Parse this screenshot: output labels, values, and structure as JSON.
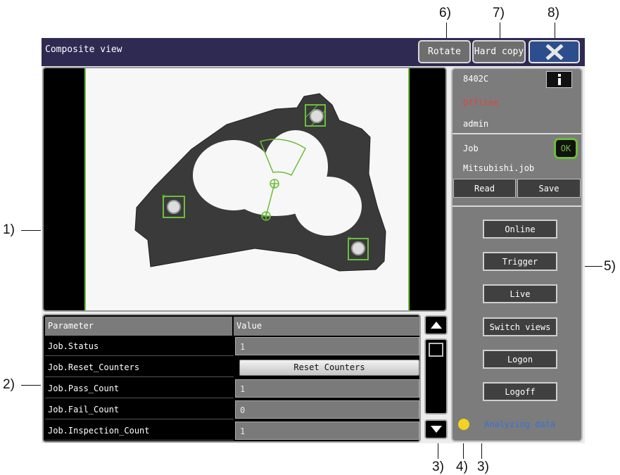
{
  "window": {
    "title": "Composite view",
    "rotate_label": "Rotate",
    "hardcopy_label": "Hard copy",
    "close_label": "✕"
  },
  "callouts": {
    "c1": "1)",
    "c2": "2)",
    "c3a": "3)",
    "c4": "4)",
    "c3b": "3)",
    "c5": "5)",
    "c6": "6)",
    "c7": "7)",
    "c8": "8)"
  },
  "table": {
    "headers": [
      "Parameter",
      "Value"
    ],
    "rows": [
      {
        "name": "Job.Status",
        "value": "1"
      },
      {
        "name": "Job.Reset_Counters",
        "value": "Reset Counters"
      },
      {
        "name": "Job.Pass_Count",
        "value": "1"
      },
      {
        "name": "Job.Fail_Count",
        "value": "0"
      },
      {
        "name": "Job.Inspection_Count",
        "value": "1"
      }
    ]
  },
  "sensor": {
    "id": "8402C",
    "status": "Offline",
    "status_color": "#e0453a",
    "user": "admin",
    "info_icon": "info-icon"
  },
  "job": {
    "label": "Job",
    "file": "Mitsubishi.job",
    "result": "OK",
    "read_label": "Read",
    "save_label": "Save"
  },
  "actions": {
    "online": "Online",
    "trigger": "Trigger",
    "live": "Live",
    "switch_views": "Switch views",
    "logon": "Logon",
    "logoff": "Logoff"
  },
  "status_message": "Analyzing data",
  "status_message_color": "#3a6fd8",
  "accent_color": "#6abf3a"
}
